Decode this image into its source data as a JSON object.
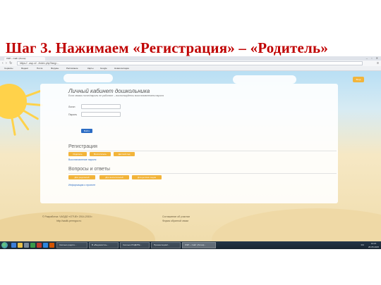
{
  "slide": {
    "title": "Шаг 3. Нажимаем «Регистрация» – «Родитель»"
  },
  "browser": {
    "tab_label": "ЛЭП – Сайт (Логин)",
    "url": "https://...asp.cl/.../index.php?lang=...",
    "bookmarks": [
      "Сервисы",
      "Яндекс",
      "Почта",
      "Форумы",
      "Расписание",
      "Карты",
      "Google",
      "Новая вкладка"
    ]
  },
  "page": {
    "login_button": "Вход",
    "card": {
      "title": "Личный кабинет дошкольника",
      "subtitle": "Если связки логин/пароль не работают – воспользуйтесь восстановлением пароля",
      "login_label": "Логин",
      "password_label": "Пароль",
      "submit_label": "Войти",
      "registration": {
        "heading": "Регистрация",
        "buttons": [
          "Родитель",
          "Воспитатель",
          "Детский сад"
        ],
        "restore_link": "Восстановление пароля"
      },
      "qa": {
        "heading": "Вопросы и ответы",
        "buttons": [
          "Для родителей",
          "Для воспитателей",
          "Для детских садов"
        ],
        "project_link": "Информация о проекте"
      }
    },
    "footer": {
      "left_line1": "© Разработка: ЧАОДО «ОТЧЕ» 2014-2015 г.",
      "left_line2": "http://sadik.permgov.ru",
      "right_line1": "Соглашение об участии",
      "right_line2": "Форма обратной связи"
    }
  },
  "taskbar": {
    "buttons": [
      "Сколько родите...",
      "В «Ведомости»...",
      "Сколько РОДИТЕ...",
      "Презентация2...",
      "ЛЭП – Сайт (Логин)..."
    ],
    "tray_lang": "RU",
    "time": "13:21",
    "date": "26.05.2015"
  }
}
